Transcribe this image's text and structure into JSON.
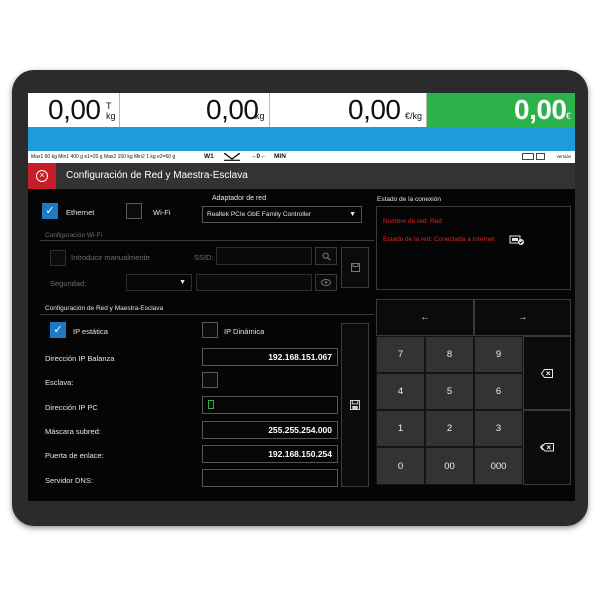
{
  "display": {
    "tare": {
      "value": "0,00",
      "unit": "T kg"
    },
    "weight": {
      "value": "0,00",
      "unit": "kg"
    },
    "unit_price": {
      "value": "0,00",
      "unit": "€/kg"
    },
    "total": {
      "value": "0,00",
      "unit": "€"
    },
    "total_color": "#2bb34a",
    "bar_color": "#1d9bdb"
  },
  "infobar": {
    "spec": "Max1 60 kg Min1 400 g e1=20 g Max2 150 kg Min2 1 kg e2=50 g",
    "scale": "W1",
    "indicator_2": "→0←",
    "indicator_3": "MIN",
    "version": "versión"
  },
  "dialog": {
    "title": "Configuración de Red y Maestra-Esclava",
    "close_color": "#c41e2a"
  },
  "connection_type": {
    "ethernet_label": "Ethernet",
    "wifi_label": "Wi-Fi",
    "ethernet_checked": true,
    "wifi_checked": false
  },
  "adapter": {
    "label": "Adaptador de red",
    "selected": "Realtek PCIe GbE Family Controller"
  },
  "wifi_config": {
    "section_label": "Configuración Wi-Fi",
    "manual_label": "Introducir manualmente",
    "ssid_label": "SSID:",
    "security_label": "Seguridad:"
  },
  "connection_status": {
    "label": "Estado de la conexión",
    "network_name": "Nombre de red: Red",
    "network_state": "Estado de la red: Conectada a Internet"
  },
  "network_config": {
    "section_label": "Configuración de Red y Maestra-Esclava",
    "static_ip_label": "IP estática",
    "dynamic_ip_label": "IP Dinámica",
    "static_checked": true,
    "dynamic_checked": false,
    "scale_ip_label": "Dirección IP Balanza",
    "scale_ip": "192.168.151.067",
    "slave_label": "Esclava:",
    "slave_checked": false,
    "pc_ip_label": "Dirección IP PC",
    "pc_ip": "",
    "subnet_label": "Máscara subred:",
    "subnet": "255.255.254.000",
    "gateway_label": "Puerta de enlace:",
    "gateway": "192.168.150.254",
    "dns_label": "Servidor DNS:",
    "dns": ""
  },
  "keypad": {
    "left_arrow": "←",
    "right_arrow": "→",
    "keys": [
      "7",
      "8",
      "9",
      "4",
      "5",
      "6",
      "1",
      "2",
      "3",
      "0",
      "00",
      "000"
    ],
    "backspace_icon": "backspace-icon",
    "clear_icon": "clear-all-icon"
  }
}
